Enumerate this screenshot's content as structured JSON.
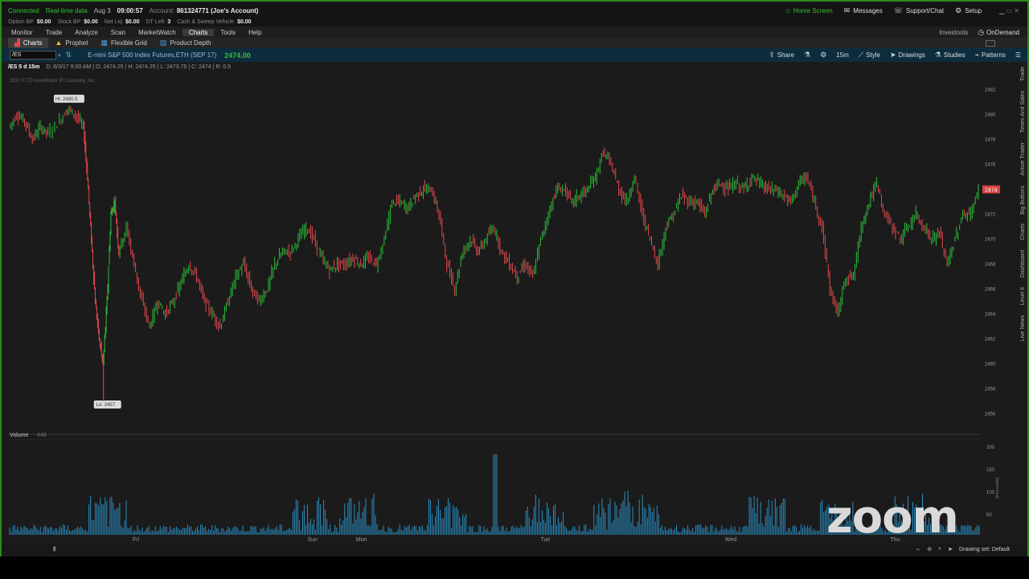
{
  "status": {
    "connected": "Connected",
    "realtime": "Real-time data",
    "date": "Aug 3",
    "time": "09:00:57",
    "account_label": "Account:",
    "account_value": "861324771 (Joe's Account)"
  },
  "balances": [
    {
      "label": "Option BP",
      "value": "$0.00"
    },
    {
      "label": "Stock BP",
      "value": "$0.00"
    },
    {
      "label": "Net Liq",
      "value": "$0.00"
    },
    {
      "label": "DT Left",
      "value": "3"
    },
    {
      "label": "Cash & Sweep Vehicle",
      "value": "$0.00"
    }
  ],
  "top_right": {
    "home": "Home Screen",
    "messages": "Messages",
    "support": "Support/Chat",
    "setup": "Setup"
  },
  "menu": {
    "items": [
      "Monitor",
      "Trade",
      "Analyze",
      "Scan",
      "MarketWatch",
      "Charts",
      "Tools",
      "Help"
    ],
    "active": "Charts",
    "investools": "Investools",
    "ondemand": "OnDemand"
  },
  "subtabs": {
    "charts": "Charts",
    "prophet": "Prophet",
    "flexgrid": "Flexible Grid",
    "product_depth": "Product Depth"
  },
  "symbol_bar": {
    "symbol": "/ES",
    "description": "E-mini S&P 500 Index Futures,ETH (SEP 17)",
    "price": "2474.00",
    "share": "Share",
    "interval": "15m",
    "style": "Style",
    "drawings": "Drawings",
    "studies": "Studies",
    "patterns": "Patterns"
  },
  "info": {
    "title": "/ES 5 d 15m",
    "ohlc": "D: 8/3/17 9:00 AM  |  O: 2474.25  |  H: 2474.25  |  L: 2473.75  |  C: 2474  |  R: 0.5",
    "copyright": "2017 © TD Ameritrade IP Company, Inc."
  },
  "colors": {
    "up": "#2bbf3a",
    "down": "#e5484d",
    "volume": "#2a8fc4",
    "frame": "#2c8a1a",
    "price_tag": "#d44343"
  },
  "chart_data": {
    "type": "line",
    "title": "/ES 5 d 15m",
    "x": [
      "Fri",
      "Sun",
      "Mon",
      "Tue",
      "Wed",
      "Thu"
    ],
    "ylim": [
      2455,
      2483
    ],
    "y_ticks": [
      2482,
      2480,
      2478,
      2476,
      2474,
      2472,
      2470,
      2468,
      2466,
      2464,
      2462,
      2460,
      2458,
      2456
    ],
    "high_label": "Hi: 2480.5",
    "low_label": "Lo: 2457",
    "last_price_label": "2474",
    "series": [
      {
        "values": [
          [
            0,
            2479.0
          ],
          [
            2,
            2480.0
          ],
          [
            4,
            2479.5
          ],
          [
            6,
            2478.0
          ],
          [
            8,
            2479.0
          ],
          [
            10,
            2478.5
          ],
          [
            13,
            2479.5
          ],
          [
            15,
            2480.5
          ],
          [
            17,
            2480.0
          ],
          [
            19,
            2479.0
          ],
          [
            20,
            2475.0
          ],
          [
            21,
            2470.0
          ],
          [
            22,
            2465.0
          ],
          [
            23,
            2462.0
          ],
          [
            24,
            2460.0
          ],
          [
            25,
            2465.0
          ],
          [
            26,
            2472.0
          ],
          [
            27,
            2473.0
          ],
          [
            28,
            2469.0
          ],
          [
            30,
            2471.0
          ],
          [
            32,
            2468.0
          ],
          [
            34,
            2465.0
          ],
          [
            36,
            2463.0
          ],
          [
            38,
            2465.0
          ],
          [
            40,
            2464.0
          ],
          [
            42,
            2465.0
          ],
          [
            44,
            2466.5
          ],
          [
            46,
            2468.0
          ],
          [
            48,
            2467.0
          ],
          [
            50,
            2465.0
          ],
          [
            52,
            2464.0
          ],
          [
            54,
            2463.0
          ],
          [
            56,
            2465.0
          ],
          [
            58,
            2467.0
          ],
          [
            60,
            2468.0
          ],
          [
            62,
            2466.0
          ],
          [
            64,
            2465.0
          ],
          [
            66,
            2466.0
          ],
          [
            68,
            2468.0
          ],
          [
            70,
            2469.0
          ],
          [
            72,
            2469.0
          ],
          [
            74,
            2470.0
          ],
          [
            76,
            2471.0
          ],
          [
            78,
            2470.0
          ],
          [
            80,
            2468.5
          ],
          [
            82,
            2467.5
          ],
          [
            84,
            2468.0
          ],
          [
            86,
            2468.0
          ],
          [
            88,
            2468.5
          ],
          [
            90,
            2468.0
          ],
          [
            92,
            2468.5
          ],
          [
            94,
            2468.0
          ],
          [
            96,
            2470.0
          ],
          [
            98,
            2473.0
          ],
          [
            100,
            2473.0
          ],
          [
            102,
            2472.5
          ],
          [
            104,
            2473.5
          ],
          [
            106,
            2474.0
          ],
          [
            108,
            2474.0
          ],
          [
            110,
            2472.0
          ],
          [
            112,
            2468.0
          ],
          [
            114,
            2466.0
          ],
          [
            116,
            2469.0
          ],
          [
            118,
            2470.0
          ],
          [
            120,
            2469.0
          ],
          [
            122,
            2470.0
          ],
          [
            124,
            2471.0
          ],
          [
            126,
            2469.0
          ],
          [
            128,
            2468.0
          ],
          [
            130,
            2467.0
          ],
          [
            132,
            2468.0
          ],
          [
            134,
            2467.0
          ],
          [
            136,
            2470.0
          ],
          [
            138,
            2472.0
          ],
          [
            140,
            2474.0
          ],
          [
            142,
            2474.0
          ],
          [
            144,
            2473.0
          ],
          [
            146,
            2473.5
          ],
          [
            148,
            2474.0
          ],
          [
            150,
            2475.0
          ],
          [
            152,
            2477.0
          ],
          [
            154,
            2476.0
          ],
          [
            156,
            2474.0
          ],
          [
            158,
            2473.0
          ],
          [
            160,
            2475.0
          ],
          [
            162,
            2472.0
          ],
          [
            164,
            2470.0
          ],
          [
            166,
            2468.0
          ],
          [
            168,
            2471.0
          ],
          [
            170,
            2472.0
          ],
          [
            172,
            2473.5
          ],
          [
            174,
            2473.0
          ],
          [
            176,
            2473.0
          ],
          [
            178,
            2472.0
          ],
          [
            180,
            2474.0
          ],
          [
            182,
            2474.5
          ],
          [
            184,
            2474.0
          ],
          [
            186,
            2474.5
          ],
          [
            188,
            2474.0
          ],
          [
            190,
            2475.0
          ],
          [
            192,
            2474.5
          ],
          [
            194,
            2474.0
          ],
          [
            196,
            2474.0
          ],
          [
            198,
            2473.5
          ],
          [
            200,
            2473.0
          ],
          [
            202,
            2474.5
          ],
          [
            204,
            2475.0
          ],
          [
            206,
            2473.0
          ],
          [
            208,
            2471.0
          ],
          [
            210,
            2466.0
          ],
          [
            212,
            2464.0
          ],
          [
            214,
            2467.0
          ],
          [
            216,
            2467.0
          ],
          [
            218,
            2471.0
          ],
          [
            220,
            2473.0
          ],
          [
            222,
            2474.5
          ],
          [
            224,
            2472.0
          ],
          [
            226,
            2471.0
          ],
          [
            228,
            2470.0
          ],
          [
            230,
            2471.0
          ],
          [
            232,
            2472.0
          ],
          [
            234,
            2471.0
          ],
          [
            236,
            2470.0
          ],
          [
            238,
            2470.5
          ],
          [
            240,
            2468.0
          ],
          [
            242,
            2470.0
          ],
          [
            244,
            2472.0
          ],
          [
            246,
            2472.0
          ],
          [
            248,
            2474.0
          ]
        ]
      }
    ]
  },
  "volume": {
    "label": "Volume",
    "value": "448",
    "y_ticks": [
      "200",
      "150",
      "100",
      "50"
    ],
    "unit": "(thousands)"
  },
  "side_tabs": [
    "Trade",
    "Times And Sales",
    "Active Trader",
    "Big Buttons",
    "Charts",
    "Dashboard",
    "Level II",
    "Live News"
  ],
  "bottom": {
    "drawing_set": "Drawing set: Default"
  },
  "watermark": "zoom"
}
